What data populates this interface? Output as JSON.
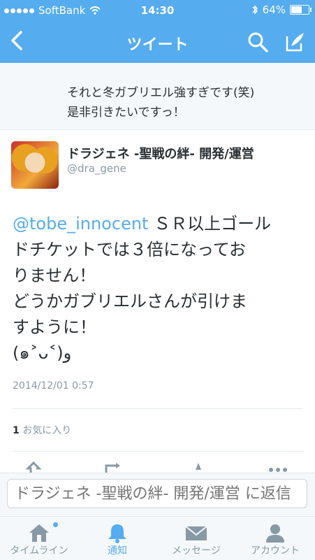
{
  "status_bar": {
    "carrier": "SoftBank",
    "time": "14:30",
    "battery": "64%"
  },
  "nav": {
    "title": "ツイート",
    "back_icon": "chevron-left-icon",
    "search_icon": "search-icon",
    "compose_icon": "compose-icon"
  },
  "context_tweet": {
    "line1": "それと冬ガブリエル強すぎです(笑)",
    "line2": "是非引きたいですっ！"
  },
  "tweet": {
    "author_name": "ドラジェネ -聖戦の絆- 開発/運営",
    "author_handle": "@dra_gene",
    "mention": "@tobe_innocent",
    "line1_rest": " ＳＲ以上ゴール",
    "line2": "ドチケットでは３倍になってお",
    "line3": "りません！",
    "line4": "どうかガブリエルさんが引けま",
    "line5": "すように！",
    "line6": "(๑˃ᴗ˂)ﻭ",
    "timestamp": "2014/12/01 0:57",
    "fav_count": "1",
    "fav_label": " お気に入り"
  },
  "reply": {
    "placeholder": "ドラジェネ -聖戦の絆- 開発/運営 に返信"
  },
  "tabs": [
    {
      "label": "タイムライン",
      "icon": "home-icon"
    },
    {
      "label": "通知",
      "icon": "bell-icon"
    },
    {
      "label": "メッセージ",
      "icon": "envelope-icon"
    },
    {
      "label": "アカウント",
      "icon": "person-icon"
    }
  ],
  "colors": {
    "accent": "#55acee",
    "text": "#292f33",
    "muted": "#8899a6"
  }
}
